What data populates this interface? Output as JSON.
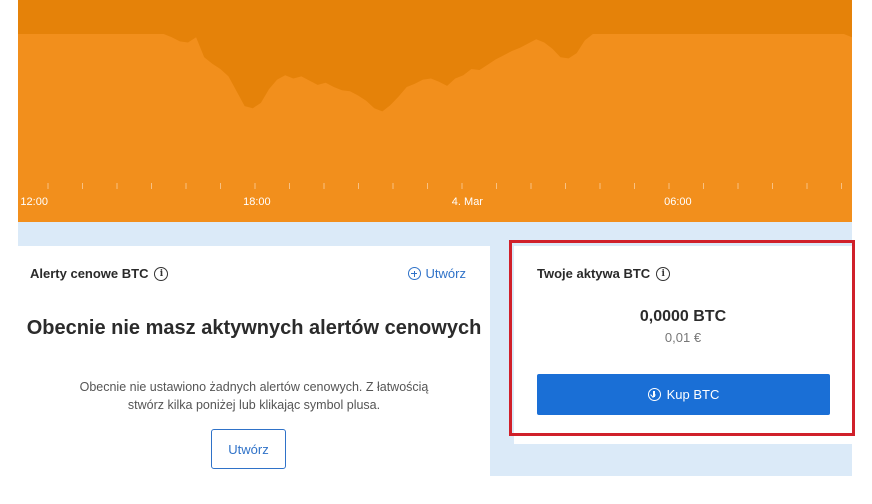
{
  "chart": {
    "x_tick_labels": [
      "12:00",
      "18:00",
      "4. Mar",
      "06:00"
    ],
    "colors": {
      "fill": "#f28f1c",
      "top_band": "#e58209",
      "tick_text": "#ffffff"
    }
  },
  "chart_data": {
    "type": "area",
    "title": "",
    "xlabel": "",
    "ylabel": "",
    "x": [
      0,
      1,
      2,
      3,
      4,
      5,
      6,
      7,
      8,
      9,
      10,
      11,
      12,
      13,
      14,
      15,
      16,
      17,
      18,
      19,
      20,
      21,
      22,
      23,
      24,
      25,
      26,
      27,
      28,
      29,
      30,
      31,
      32,
      33,
      34,
      35,
      36,
      37,
      38,
      39,
      40,
      41,
      42,
      43,
      44,
      45,
      46,
      47,
      48,
      49,
      50,
      51,
      52,
      53,
      54,
      55,
      56,
      57,
      58,
      59,
      60,
      61,
      62,
      63,
      64,
      65,
      66,
      67,
      68,
      69,
      70,
      71,
      72,
      73,
      74,
      75,
      76,
      77,
      78,
      79,
      80,
      81,
      82,
      83,
      84,
      85,
      86,
      87,
      88,
      89,
      90,
      91,
      92,
      93,
      94,
      95,
      96,
      97,
      98,
      99,
      100,
      101,
      102,
      103
    ],
    "values": [
      100,
      100,
      100,
      100,
      100,
      100,
      100,
      100,
      100,
      100,
      100,
      100,
      100,
      100,
      100,
      100,
      100,
      100,
      100,
      97,
      93,
      92,
      97,
      78,
      72,
      67,
      60,
      46,
      32,
      30,
      35,
      48,
      57,
      61,
      58,
      60,
      56,
      52,
      54,
      50,
      47,
      46,
      42,
      37,
      30,
      27,
      33,
      41,
      50,
      53,
      57,
      58,
      55,
      51,
      58,
      61,
      67,
      66,
      71,
      76,
      80,
      84,
      87,
      91,
      95,
      92,
      86,
      78,
      77,
      82,
      94,
      100,
      100,
      100,
      100,
      100,
      100,
      100,
      100,
      100,
      100,
      100,
      100,
      100,
      100,
      100,
      100,
      100,
      100,
      100,
      100,
      100,
      100,
      100,
      100,
      100,
      100,
      100,
      100,
      100,
      100,
      100,
      100,
      97
    ],
    "ylim": [
      0,
      100
    ],
    "x_tick_positions": [
      2,
      29.5,
      55.5,
      81.5
    ],
    "grid": false,
    "fill_color": "#f28f1c"
  },
  "alerts": {
    "title": "Alerty cenowe BTC",
    "create_link": "Utwórz",
    "empty_title": "Obecnie nie masz aktywnych alertów cenowych",
    "empty_desc": "Obecnie nie ustawiono żadnych alertów cenowych. Z łatwością stwórz kilka poniżej lub klikając symbol plusa.",
    "create_button": "Utwórz"
  },
  "assets": {
    "title": "Twoje aktywa BTC",
    "balance": "0,0000 BTC",
    "fiat": "0,01 €",
    "buy_button": "Kup BTC"
  },
  "colors": {
    "accent_blue": "#1a6fd6",
    "link_blue": "#2f72c8",
    "highlight_red": "#d0202a",
    "page_band": "#dbeaf8"
  },
  "icons": {
    "info": "info-icon",
    "plus": "plus-circle-icon",
    "download": "download-circle-icon"
  }
}
